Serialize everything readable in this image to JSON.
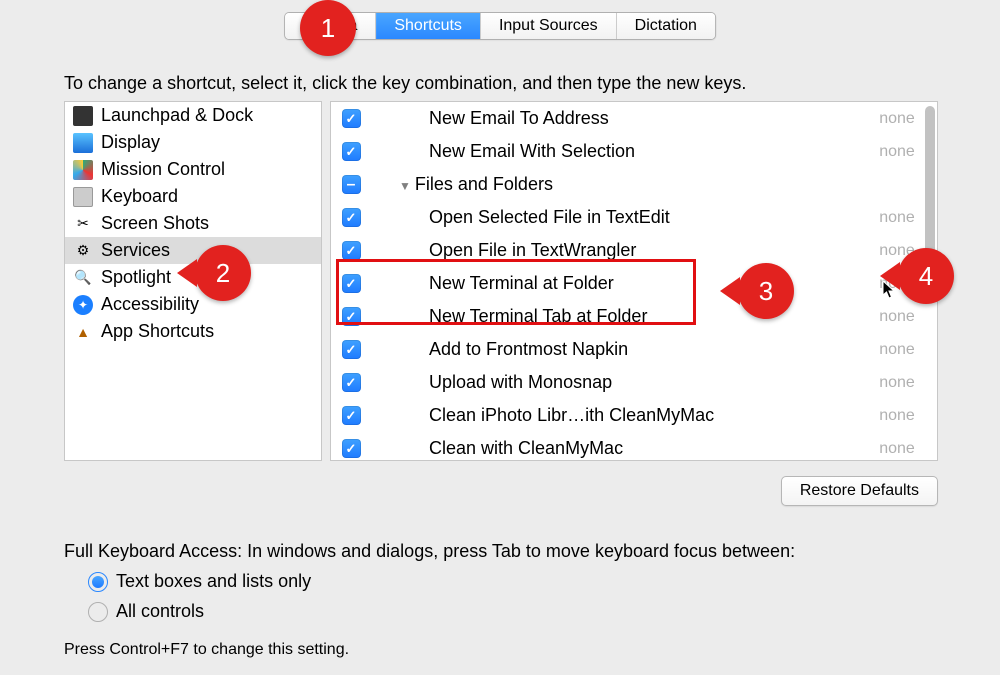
{
  "tabs": {
    "keyboard": "Keyboa",
    "shortcuts": "Shortcuts",
    "input_sources": "Input Sources",
    "dictation": "Dictation"
  },
  "instruction": "To change a shortcut, select it, click the key combination, and then type the new keys.",
  "categories": [
    {
      "label": "Launchpad & Dock"
    },
    {
      "label": "Display"
    },
    {
      "label": "Mission Control"
    },
    {
      "label": "Keyboard"
    },
    {
      "label": "Screen Shots"
    },
    {
      "label": "Services"
    },
    {
      "label": "Spotlight"
    },
    {
      "label": "Accessibility"
    },
    {
      "label": "App Shortcuts"
    }
  ],
  "services": [
    {
      "label": "New Email To Address",
      "key": "none",
      "indent": "item",
      "chk": "check"
    },
    {
      "label": "New Email With Selection",
      "key": "none",
      "indent": "item",
      "chk": "check"
    },
    {
      "label": "Files and Folders",
      "key": "",
      "indent": "group",
      "chk": "minus"
    },
    {
      "label": "Open Selected File in TextEdit",
      "key": "none",
      "indent": "item",
      "chk": "check"
    },
    {
      "label": "Open File in TextWrangler",
      "key": "none",
      "indent": "item",
      "chk": "check"
    },
    {
      "label": "New Terminal at Folder",
      "key": "none",
      "indent": "item",
      "chk": "check"
    },
    {
      "label": "New Terminal Tab at Folder",
      "key": "none",
      "indent": "item",
      "chk": "check"
    },
    {
      "label": "Add to Frontmost Napkin",
      "key": "none",
      "indent": "item",
      "chk": "check"
    },
    {
      "label": "Upload with Monosnap",
      "key": "none",
      "indent": "item",
      "chk": "check"
    },
    {
      "label": "Clean iPhoto Libr…ith CleanMyMac",
      "key": "none",
      "indent": "item",
      "chk": "check"
    },
    {
      "label": "Clean with CleanMyMac",
      "key": "none",
      "indent": "item",
      "chk": "check"
    }
  ],
  "restore": "Restore Defaults",
  "kbd_access": "Full Keyboard Access: In windows and dialogs, press Tab to move keyboard focus between:",
  "radio1": "Text boxes and lists only",
  "radio2": "All controls",
  "hint": "Press Control+F7 to change this setting.",
  "callouts": {
    "c1": "1",
    "c2": "2",
    "c3": "3",
    "c4": "4"
  }
}
